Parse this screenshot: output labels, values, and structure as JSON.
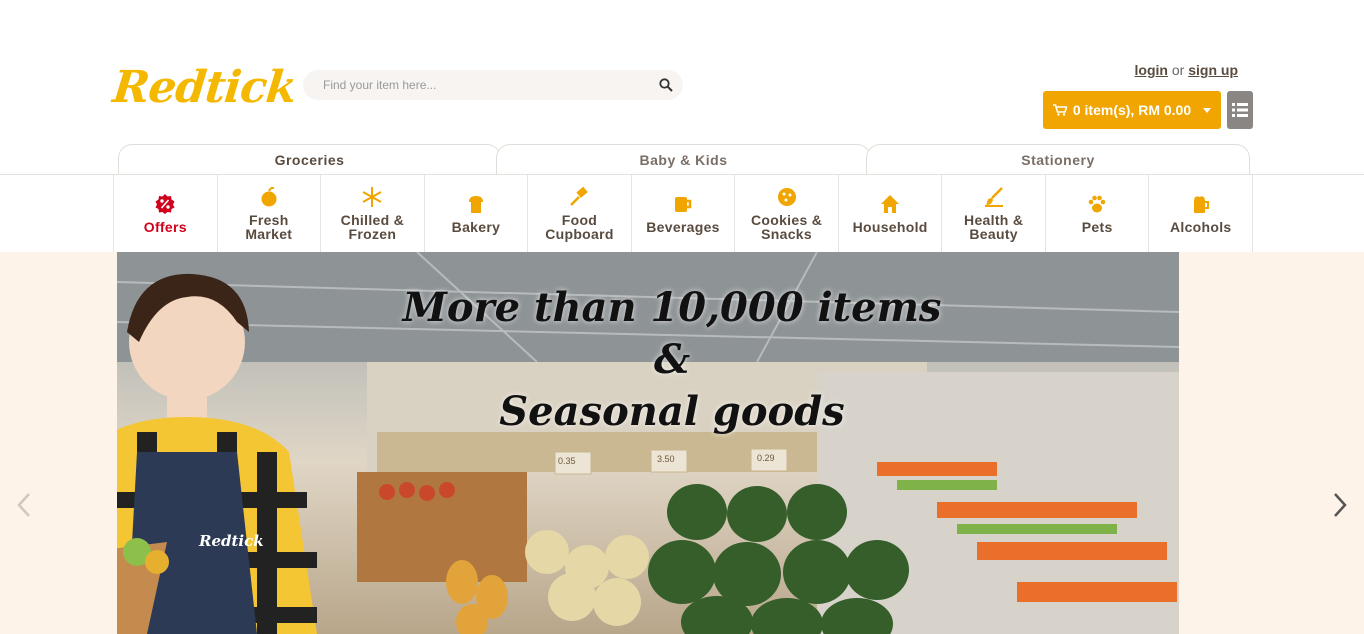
{
  "brand": {
    "logo_text": "Redtick",
    "accent": "#f5b800"
  },
  "search": {
    "placeholder": "Find your item here..."
  },
  "auth": {
    "login": "login",
    "or": "or",
    "signup": "sign up"
  },
  "cart": {
    "label": "0 item(s), RM 0.00",
    "color": "#f0a500"
  },
  "tabs": [
    {
      "label": "Groceries"
    },
    {
      "label": "Baby & Kids"
    },
    {
      "label": "Stationery"
    }
  ],
  "categories": [
    {
      "label": "Offers",
      "icon": "percent-badge-icon"
    },
    {
      "label": "Fresh\nMarket",
      "icon": "apple-icon"
    },
    {
      "label": "Chilled &\nFrozen",
      "icon": "snowflake-icon"
    },
    {
      "label": "Bakery",
      "icon": "bread-icon"
    },
    {
      "label": "Food\nCupboard",
      "icon": "spatula-icon"
    },
    {
      "label": "Beverages",
      "icon": "mug-icon"
    },
    {
      "label": "Cookies &\nSnacks",
      "icon": "cookie-icon"
    },
    {
      "label": "Household",
      "icon": "house-icon"
    },
    {
      "label": "Health &\nBeauty",
      "icon": "brush-icon"
    },
    {
      "label": "Pets",
      "icon": "paw-icon"
    },
    {
      "label": "Alcohols",
      "icon": "beer-icon"
    }
  ],
  "hero": {
    "line1": "More than 10,000 items",
    "line2": "&",
    "line3": "Seasonal goods",
    "apron_text": "Redtick",
    "price_tags": [
      "0.35",
      "3.50",
      "0.29"
    ]
  }
}
